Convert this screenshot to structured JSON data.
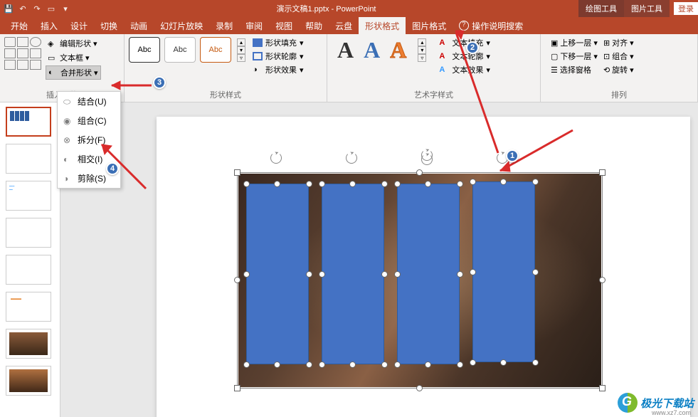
{
  "titlebar": {
    "doc_title": "演示文稿1.pptx - PowerPoint",
    "context_tabs": {
      "drawing": "绘图工具",
      "picture": "图片工具"
    },
    "login": "登录"
  },
  "tabs": {
    "start": "开始",
    "insert": "插入",
    "design": "设计",
    "transition": "切换",
    "animation": "动画",
    "slideshow": "幻灯片放映",
    "record": "录制",
    "review": "审阅",
    "view": "视图",
    "help": "帮助",
    "cloud": "云盘",
    "shape_format": "形状格式",
    "picture_format": "图片格式",
    "tell_me": "操作说明搜索"
  },
  "ribbon": {
    "insert_shapes_label": "插入形状",
    "edit_shape": "编辑形状",
    "text_box": "文本框",
    "merge_shapes": "合并形状",
    "shape_styles_label": "形状样式",
    "abc": "Abc",
    "shape_fill": "形状填充",
    "shape_outline": "形状轮廓",
    "shape_effects": "形状效果",
    "wordart_label": "艺术字样式",
    "wa_letter": "A",
    "text_fill": "文本填充",
    "text_outline": "文本轮廓",
    "text_effects": "文本效果",
    "arrange_label": "排列",
    "bring_forward": "上移一层",
    "send_backward": "下移一层",
    "selection_pane": "选择窗格",
    "align": "对齐",
    "group": "组合",
    "rotate": "旋转"
  },
  "merge_menu": {
    "union": "结合(U)",
    "combine": "组合(C)",
    "fragment": "拆分(F)",
    "intersect": "相交(I)",
    "subtract": "剪除(S)"
  },
  "badges": {
    "b1": "1",
    "b2": "2",
    "b3": "3",
    "b4": "4"
  },
  "watermark": {
    "name": "极光下载站",
    "url": "www.xz7.com"
  }
}
